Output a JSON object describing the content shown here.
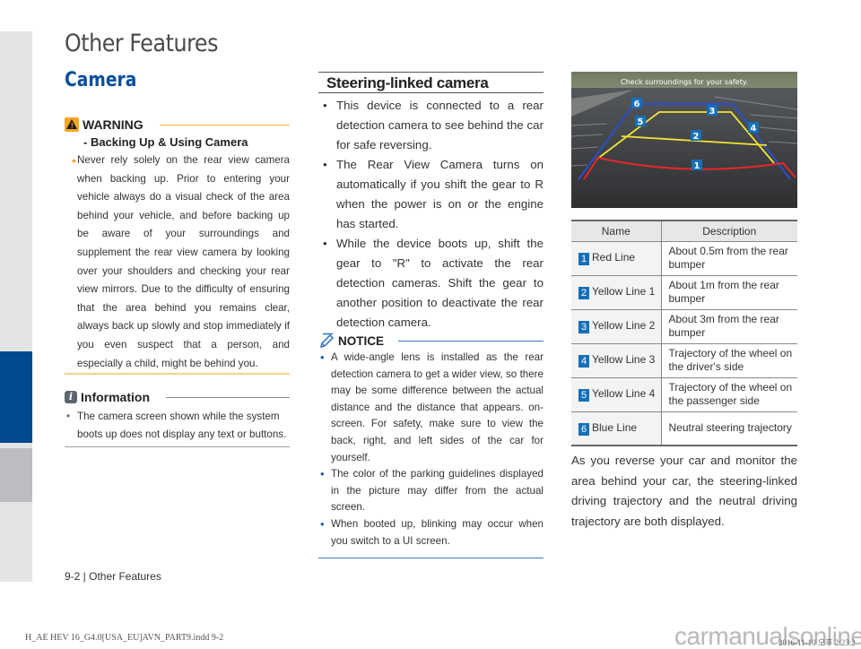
{
  "page": {
    "title": "Other Features",
    "section": "Camera",
    "footer_label": "9-2 | Other Features",
    "footer_file": "H_AE HEV 16_G4.0[USA_EU]AVN_PART9.indd   9-2",
    "watermark": "carmanualsonline.info",
    "footer_date": "2016-11-10  오후 2:23:2",
    "accent_color": "#004a8f"
  },
  "warning": {
    "label": "WARNING",
    "subtitle": "- Backing Up & Using Camera",
    "bullet": "•",
    "text": "Never rely solely on the rear view camera when backing up. Prior to entering your vehicle always do a visual check of the area behind your vehicle, and before backing up be aware of your surroundings and supplement the rear view camera by looking over your shoulders and checking your rear view mirrors. Due to the difficulty of ensuring that the area behind you remains clear, always back up slowly and stop immediately if you even suspect that a person, and especially a child, might be behind you."
  },
  "information": {
    "icon_glyph": "i",
    "label": "Information",
    "bullet": "•",
    "text": "The camera screen shown while the system boots up does not display any text or buttons."
  },
  "steering": {
    "title": "Steering-linked camera",
    "bullet": "•",
    "items": [
      "This device is connected to a rear detection camera to see behind the car for safe reversing.",
      "The Rear View Camera turns on automatically if you shift the gear to R when the power is on or the engine has started.",
      "While the device boots up, shift the gear to \"R\" to activate the rear detection cameras. Shift the gear to another position to deactivate the rear detection camera."
    ]
  },
  "notice": {
    "label": "NOTICE",
    "bullet": "•",
    "items": [
      "A wide-angle lens is installed as the rear detection camera to get a wider view, so there may be some difference between the actual distance and the distance that appears. on-screen. For safety, make sure to view the back, right, and left sides of the car for yourself.",
      "The color of the parking guidelines displayed in the picture may differ from the actual screen.",
      "When booted up, blinking may occur when you switch to a UI screen."
    ]
  },
  "camera_screen": {
    "overlay_text": "Check surroundings for your safety.",
    "markers": [
      "1",
      "2",
      "3",
      "4",
      "5",
      "6"
    ],
    "line_colors": {
      "red": "#e8262b",
      "yellow": "#f2e533",
      "blue": "#2a4fc8"
    }
  },
  "table": {
    "headers": [
      "Name",
      "Description"
    ],
    "rows": [
      {
        "num": "1",
        "name": "Red Line",
        "desc": "About 0.5m from the rear bumper"
      },
      {
        "num": "2",
        "name": "Yellow Line 1",
        "desc": "About 1m from the rear bumper"
      },
      {
        "num": "3",
        "name": "Yellow Line 2",
        "desc": "About 3m from the rear bumper"
      },
      {
        "num": "4",
        "name": "Yellow Line 3",
        "desc": "Trajectory of the wheel on the driver's side"
      },
      {
        "num": "5",
        "name": "Yellow Line 4",
        "desc": "Trajectory of the wheel on the passenger side"
      },
      {
        "num": "6",
        "name": "Blue Line",
        "desc": "Neutral steering trajectory"
      }
    ]
  },
  "summary": "As you reverse your car and monitor the area behind your car, the steering-linked driving trajectory and the neutral driving trajectory are both displayed."
}
